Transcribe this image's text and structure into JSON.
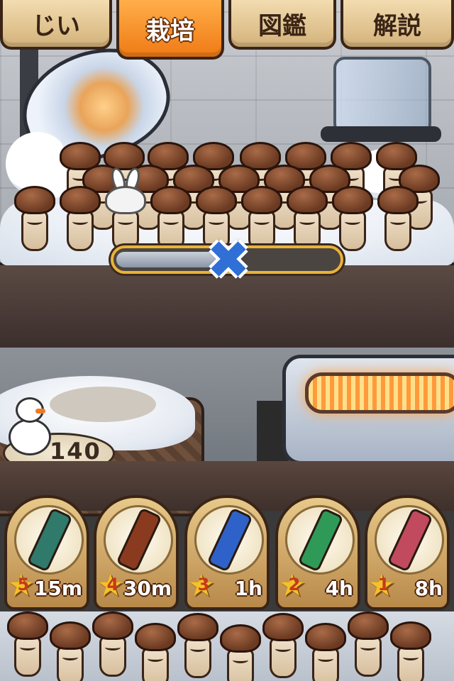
{
  "tabs": [
    {
      "label": "じい",
      "active": false
    },
    {
      "label": "栽培",
      "active": true
    },
    {
      "label": "図鑑",
      "active": false
    },
    {
      "label": "解説",
      "active": false
    }
  ],
  "counter": {
    "value": "140"
  },
  "harvest_progress": {
    "fraction": 0.5
  },
  "items": [
    {
      "stars": "5",
      "time": "15m",
      "icon": "green-bottle-icon",
      "color": "#2f7a6a"
    },
    {
      "stars": "4",
      "time": "30m",
      "icon": "brown-bottle-icon",
      "color": "#8a3a1f"
    },
    {
      "stars": "3",
      "time": "1h",
      "icon": "blue-syringe-icon",
      "color": "#2f62c8"
    },
    {
      "stars": "2",
      "time": "4h",
      "icon": "green-ampoule-icon",
      "color": "#2f9a58"
    },
    {
      "stars": "1",
      "time": "8h",
      "icon": "red-ampoule-icon",
      "color": "#c14a5e"
    }
  ],
  "colors": {
    "active_tab": "#ef7a14",
    "tab": "#d3b27a",
    "progress_border": "#e9b23a",
    "x_mark": "#2f6fd6"
  }
}
